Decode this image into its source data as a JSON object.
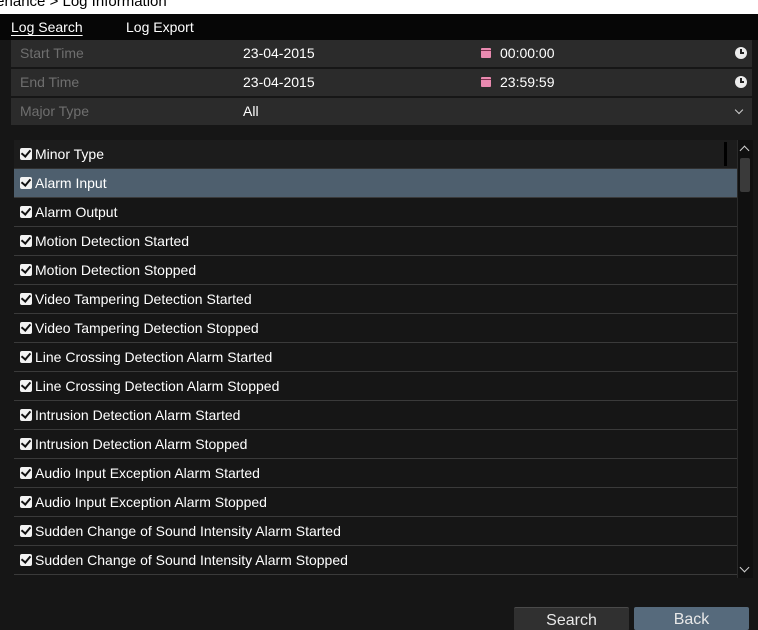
{
  "breadcrumb": "aintenance > Log Information",
  "tabs": [
    {
      "label": "Log Search",
      "active": true
    },
    {
      "label": "Log Export",
      "active": false
    }
  ],
  "form": {
    "start_time": {
      "label": "Start Time",
      "date": "23-04-2015",
      "time": "00:00:00"
    },
    "end_time": {
      "label": "End Time",
      "date": "23-04-2015",
      "time": "23:59:59"
    },
    "major_type": {
      "label": "Major Type",
      "value": "All"
    }
  },
  "minor_type": {
    "header": "Minor Type",
    "items": [
      "Alarm Input",
      "Alarm Output",
      "Motion Detection Started",
      "Motion Detection Stopped",
      "Video Tampering Detection Started",
      "Video Tampering Detection Stopped",
      "Line Crossing Detection Alarm Started",
      "Line Crossing Detection Alarm Stopped",
      "Intrusion Detection Alarm Started",
      "Intrusion Detection Alarm Stopped",
      "Audio Input Exception Alarm Started",
      "Audio Input Exception Alarm Stopped",
      "Sudden Change of Sound Intensity Alarm Started",
      "Sudden Change of Sound Intensity Alarm Stopped"
    ]
  },
  "buttons": {
    "search": "Search",
    "back": "Back"
  },
  "colors": {
    "panel": "#161616",
    "selected_row": "#4e5f6e",
    "back_button": "#566a7c"
  }
}
